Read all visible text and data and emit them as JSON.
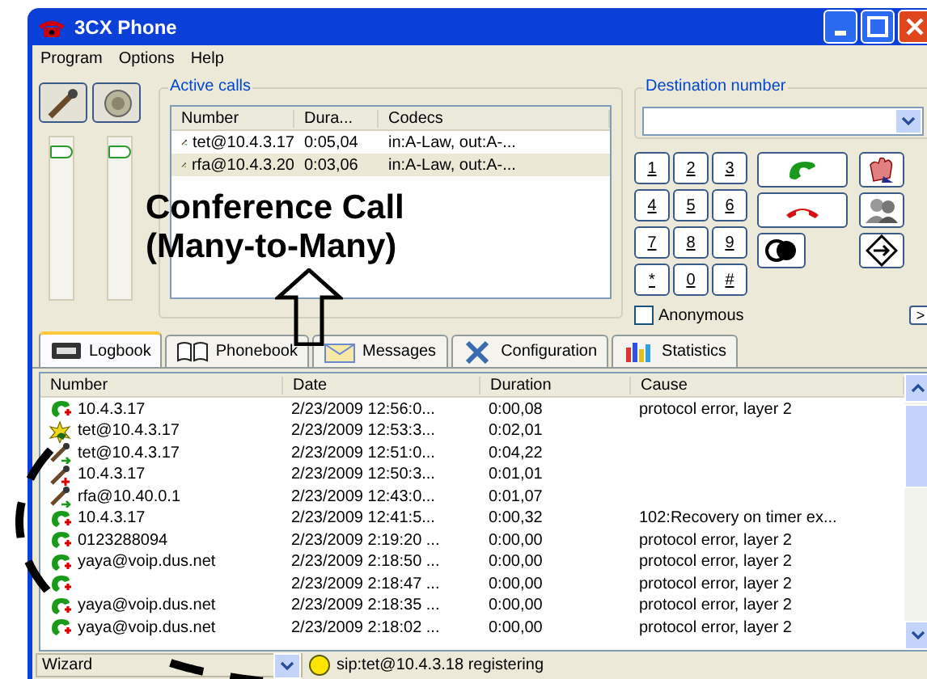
{
  "window": {
    "title": "3CX Phone"
  },
  "menu": [
    "Program",
    "Options",
    "Help"
  ],
  "audio": {
    "sliders": [
      {
        "level": 0.95
      },
      {
        "level": 0.95
      }
    ]
  },
  "active_calls": {
    "title": "Active calls",
    "columns": [
      "Number",
      "Dura...",
      "Codecs"
    ],
    "rows": [
      {
        "number": "tet@10.4.3.17",
        "duration": "0:05,04",
        "codecs": "in:A-Law, out:A-...",
        "selected": false
      },
      {
        "number": "rfa@10.4.3.20",
        "duration": "0:03,06",
        "codecs": "in:A-Law, out:A-...",
        "selected": true
      }
    ]
  },
  "destination": {
    "label": "Destination number"
  },
  "keypad": [
    "1",
    "2",
    "3",
    "4",
    "5",
    "6",
    "7",
    "8",
    "9",
    "*",
    "0",
    "#"
  ],
  "anonymous": {
    "label": "Anonymous",
    "checked": false
  },
  "more_button": ">",
  "tabs": [
    {
      "label": "Logbook",
      "selected": true
    },
    {
      "label": "Phonebook",
      "selected": false
    },
    {
      "label": "Messages",
      "selected": false
    },
    {
      "label": "Configuration",
      "selected": false
    },
    {
      "label": "Statistics",
      "selected": false
    }
  ],
  "logbook": {
    "columns": [
      "Number",
      "Date",
      "Duration",
      "Cause"
    ],
    "rows": [
      {
        "kind": "phone",
        "number": "10.4.3.17",
        "date": "2/23/2009 12:56:0...",
        "duration": "0:00,08",
        "cause": "protocol error, layer 2"
      },
      {
        "kind": "alert",
        "number": "tet@10.4.3.17",
        "date": "2/23/2009 12:53:3...",
        "duration": "0:02,01",
        "cause": ""
      },
      {
        "kind": "mic-out",
        "number": "tet@10.4.3.17",
        "date": "2/23/2009 12:51:0...",
        "duration": "0:04,22",
        "cause": ""
      },
      {
        "kind": "mic-in",
        "number": "10.4.3.17",
        "date": "2/23/2009 12:50:3...",
        "duration": "0:01,01",
        "cause": ""
      },
      {
        "kind": "mic-out",
        "number": "rfa@10.40.0.1",
        "date": "2/23/2009 12:43:0...",
        "duration": "0:01,07",
        "cause": ""
      },
      {
        "kind": "phone",
        "number": "10.4.3.17",
        "date": "2/23/2009 12:41:5...",
        "duration": "0:00,32",
        "cause": "102:Recovery on timer ex..."
      },
      {
        "kind": "phone",
        "number": "0123288094",
        "date": "2/23/2009 2:19:20 ...",
        "duration": "0:00,00",
        "cause": "protocol error, layer 2"
      },
      {
        "kind": "phone",
        "number": "yaya@voip.dus.net",
        "date": "2/23/2009 2:18:50 ...",
        "duration": "0:00,00",
        "cause": "protocol error, layer 2"
      },
      {
        "kind": "phone",
        "number": "",
        "date": "2/23/2009 2:18:47 ...",
        "duration": "0:00,00",
        "cause": "protocol error, layer 2"
      },
      {
        "kind": "phone",
        "number": "yaya@voip.dus.net",
        "date": "2/23/2009 2:18:35 ...",
        "duration": "0:00,00",
        "cause": "protocol error, layer 2"
      },
      {
        "kind": "phone",
        "number": "yaya@voip.dus.net",
        "date": "2/23/2009 2:18:02 ...",
        "duration": "0:00,00",
        "cause": "protocol error, layer 2"
      }
    ]
  },
  "status_bar": {
    "profile": "Wizard",
    "status": "sip:tet@10.4.3.18 registering"
  },
  "annotation": {
    "lines": [
      "Conference Call",
      "(Many-to-Many)"
    ]
  }
}
